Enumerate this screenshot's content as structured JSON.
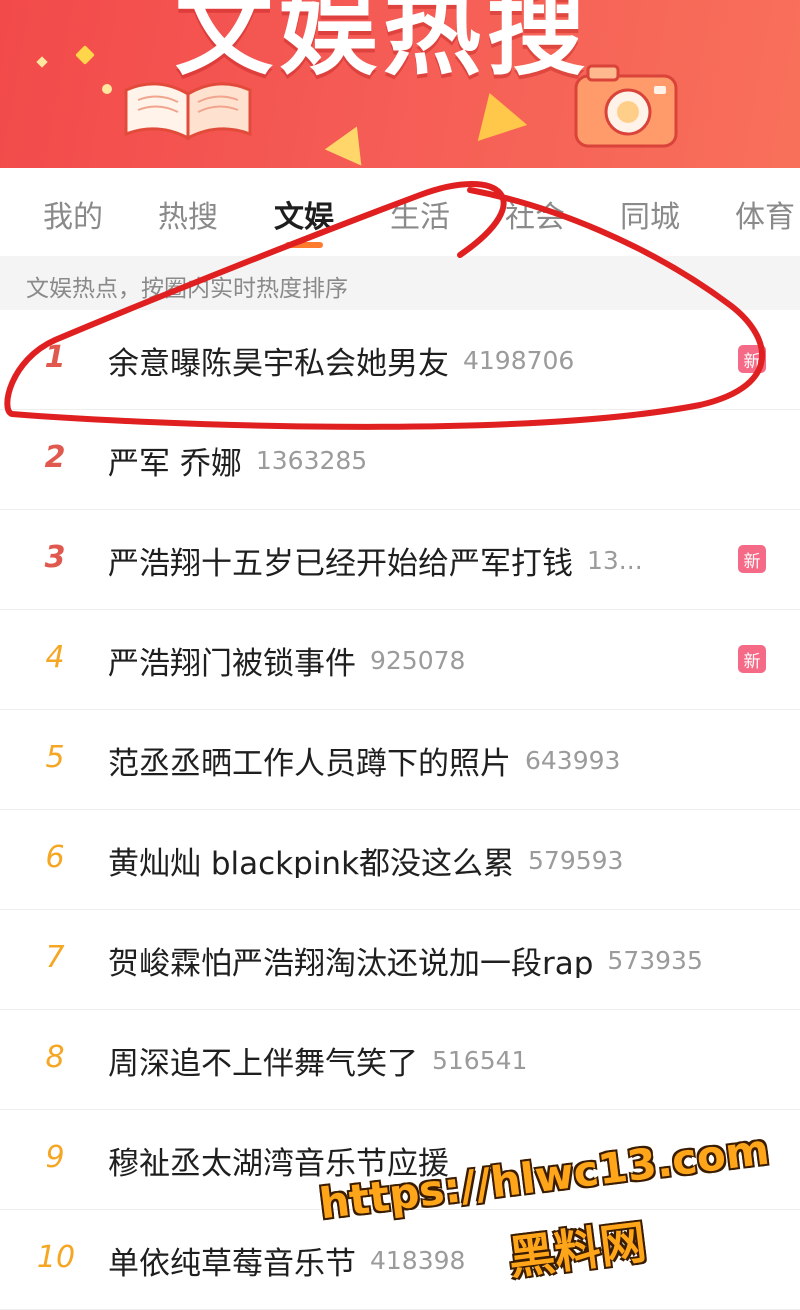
{
  "banner": {
    "title": "文娱热搜",
    "title_color": "#ffffff",
    "background": "#f24a4a"
  },
  "tabs": [
    {
      "label": "我的",
      "active": false
    },
    {
      "label": "热搜",
      "active": false
    },
    {
      "label": "文娱",
      "active": true
    },
    {
      "label": "生活",
      "active": false
    },
    {
      "label": "社会",
      "active": false
    },
    {
      "label": "同城",
      "active": false
    },
    {
      "label": "体育",
      "active": false
    }
  ],
  "subtitle": "文娱热点，按圈内实时热度排序",
  "items": [
    {
      "rank": "1",
      "title": "余意曝陈昊宇私会她男友",
      "heat": "4198706",
      "badge": "新"
    },
    {
      "rank": "2",
      "title": "严军 乔娜",
      "heat": "1363285",
      "badge": ""
    },
    {
      "rank": "3",
      "title": "严浩翔十五岁已经开始给严军打钱",
      "heat": "13...",
      "badge": "新"
    },
    {
      "rank": "4",
      "title": "严浩翔门被锁事件",
      "heat": "925078",
      "badge": "新"
    },
    {
      "rank": "5",
      "title": "范丞丞晒工作人员蹲下的照片",
      "heat": "643993",
      "badge": ""
    },
    {
      "rank": "6",
      "title": "黄灿灿 blackpink都没这么累",
      "heat": "579593",
      "badge": ""
    },
    {
      "rank": "7",
      "title": "贺峻霖怕严浩翔淘汰还说加一段rap",
      "heat": "573935",
      "badge": ""
    },
    {
      "rank": "8",
      "title": "周深追不上伴舞气笑了",
      "heat": "516541",
      "badge": ""
    },
    {
      "rank": "9",
      "title": "穆祉丞太湖湾音乐节应援",
      "heat": "",
      "badge": ""
    },
    {
      "rank": "10",
      "title": "单依纯草莓音乐节",
      "heat": "418398",
      "badge": ""
    }
  ],
  "watermark": {
    "url": "https://hlwc13.com",
    "site": "黑料网",
    "color": "#ffa51a"
  },
  "colors": {
    "accent": "#ff7b2e",
    "rank_top": "#e0584e",
    "rank_normal": "#f5a623",
    "badge": "#f56a86",
    "annotation": "#e02020"
  }
}
